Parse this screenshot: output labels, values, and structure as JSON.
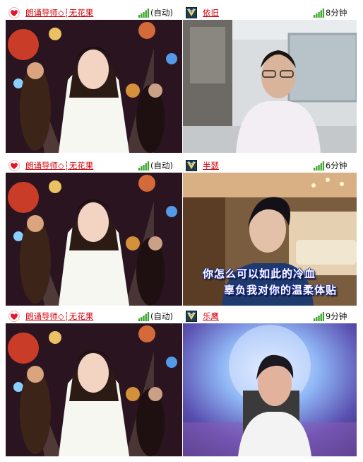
{
  "rows": [
    {
      "left": {
        "name": "朗诵导师◇┆无花果",
        "status": "(自动)",
        "icon": "heart-icon"
      },
      "right": {
        "name": "依旧",
        "status": "8分钟",
        "icon": "user-avatar-icon"
      }
    },
    {
      "left": {
        "name": "朗诵导师◇┆无花果",
        "status": "(自动)",
        "icon": "heart-icon"
      },
      "right": {
        "name": "半瑟",
        "status": "6分钟",
        "icon": "user-avatar-icon",
        "lyrics": [
          "你怎么可以如此的冷血",
          "辜负我对你的温柔体贴"
        ]
      }
    },
    {
      "left": {
        "name": "朗诵导师◇┆无花果",
        "status": "(自动)",
        "icon": "heart-icon"
      },
      "right": {
        "name": "乐鹰",
        "status": "9分钟",
        "icon": "user-avatar-icon"
      }
    }
  ],
  "colors": {
    "name": "#d4000b",
    "signal": "#3aa52a",
    "heart": "#e3162c"
  }
}
